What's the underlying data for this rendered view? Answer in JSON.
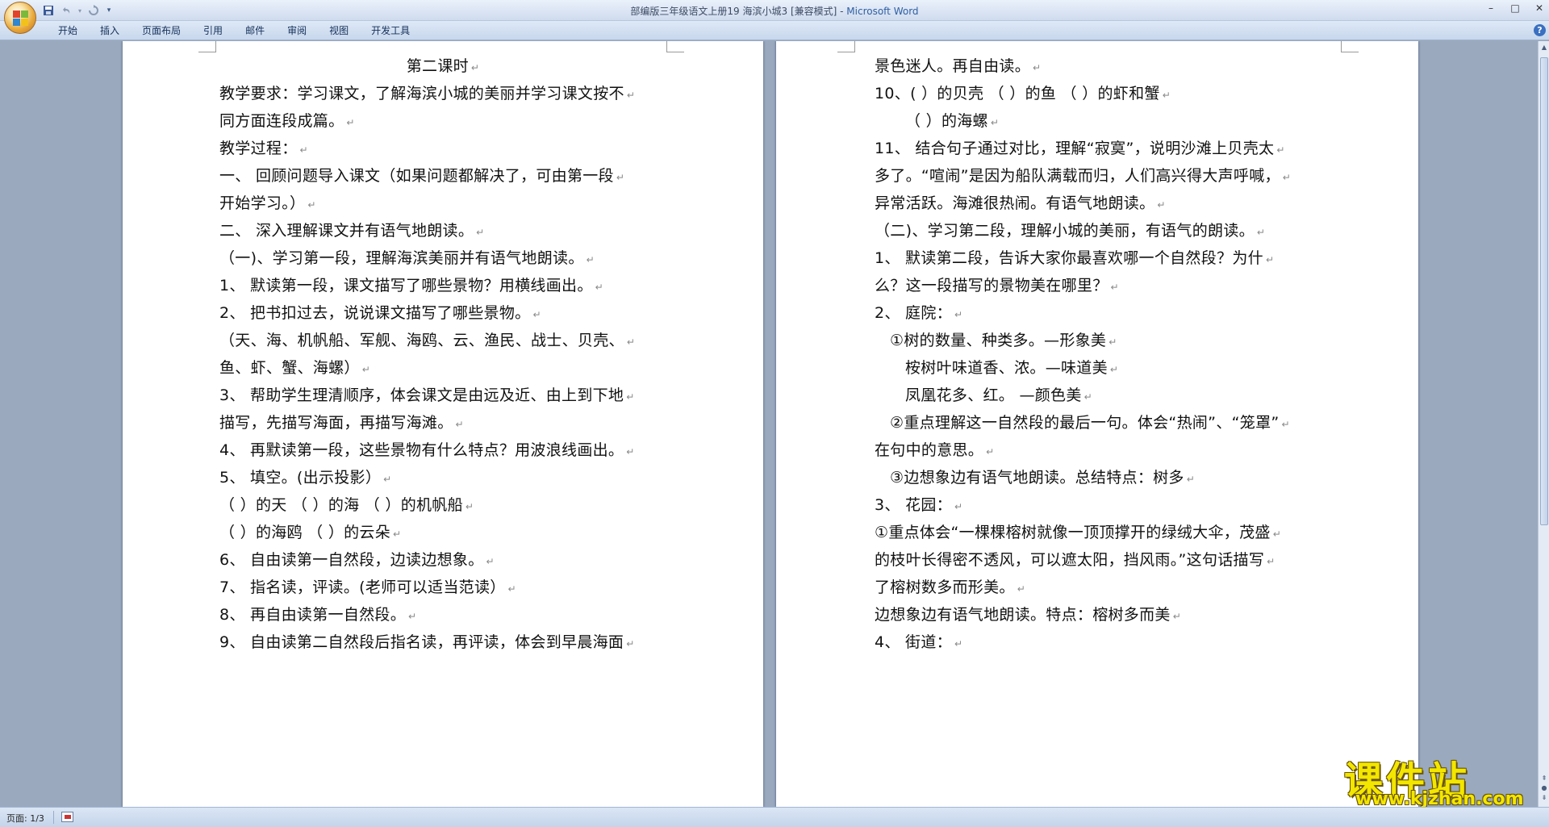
{
  "window": {
    "title_doc": "部编版三年级语文上册19 海滨小城3 [兼容模式] - ",
    "title_app": "Microsoft Word",
    "minimize": "–",
    "maximize": "□",
    "close": "✕"
  },
  "quick_access": {
    "save_icon": "save-icon",
    "undo_icon": "undo-icon",
    "redo_icon": "redo-icon",
    "customize_icon": "dropdown-icon"
  },
  "ribbon_tabs": [
    "开始",
    "插入",
    "页面布局",
    "引用",
    "邮件",
    "审阅",
    "视图",
    "开发工具"
  ],
  "help": "?",
  "document": {
    "left_page": [
      {
        "text": "第二课时",
        "indent": "center"
      },
      {
        "text": "教学要求：学习课文，了解海滨小城的美丽并学习课文按不",
        "indent": "0"
      },
      {
        "text": "同方面连段成篇。",
        "indent": "0"
      },
      {
        "text": "教学过程：",
        "indent": "0"
      },
      {
        "text": "一、  回顾问题导入课文（如果问题都解决了，可由第一段",
        "indent": "0"
      },
      {
        "text": "开始学习。）",
        "indent": "0"
      },
      {
        "text": "二、  深入理解课文并有语气地朗读。",
        "indent": "0"
      },
      {
        "text": "（一)、学习第一段，理解海滨美丽并有语气地朗读。",
        "indent": "0"
      },
      {
        "text": "1、  默读第一段，课文描写了哪些景物？用横线画出。",
        "indent": "0"
      },
      {
        "text": "2、  把书扣过去，说说课文描写了哪些景物。",
        "indent": "0"
      },
      {
        "text": "（天、海、机帆船、军舰、海鸥、云、渔民、战士、贝壳、",
        "indent": "0"
      },
      {
        "text": "鱼、虾、蟹、海螺）",
        "indent": "0"
      },
      {
        "text": "3、  帮助学生理清顺序，体会课文是由远及近、由上到下地",
        "indent": "0"
      },
      {
        "text": "描写，先描写海面，再描写海滩。",
        "indent": "0"
      },
      {
        "text": "4、  再默读第一段，这些景物有什么特点？用波浪线画出。",
        "indent": "0"
      },
      {
        "text": "5、  填空。(出示投影）",
        "indent": "0"
      },
      {
        "text": "（    ）的天      （    ）的海      （    ）的机帆船",
        "indent": "0"
      },
      {
        "text": "（    ）的海鸥    （    ）的云朵",
        "indent": "0"
      },
      {
        "text": "6、  自由读第一自然段，边读边想象。",
        "indent": "0"
      },
      {
        "text": "7、  指名读，评读。(老师可以适当范读）",
        "indent": "0"
      },
      {
        "text": "8、  再自由读第一自然段。",
        "indent": "0"
      },
      {
        "text": "9、  自由读第二自然段后指名读，再评读，体会到早晨海面",
        "indent": "0"
      }
    ],
    "right_page": [
      {
        "text": "景色迷人。再自由读。",
        "indent": "0"
      },
      {
        "text": "10、(    ）的贝壳      （    ）的鱼     （    ）的虾和蟹",
        "indent": "0"
      },
      {
        "text": "（    ）的海螺",
        "indent": "1"
      },
      {
        "text": "11、  结合句子通过对比，理解“寂寞”，说明沙滩上贝壳太",
        "indent": "0"
      },
      {
        "text": "多了。“喧闹”是因为船队满载而归，人们高兴得大声呼喊，",
        "indent": "0"
      },
      {
        "text": "异常活跃。海滩很热闹。有语气地朗读。",
        "indent": "0"
      },
      {
        "text": "（二)、学习第二段，理解小城的美丽，有语气的朗读。",
        "indent": "0"
      },
      {
        "text": "1、  默读第二段，告诉大家你最喜欢哪一个自然段？为什",
        "indent": "0"
      },
      {
        "text": "么？这一段描写的景物美在哪里？",
        "indent": "0"
      },
      {
        "text": "2、  庭院：",
        "indent": "0"
      },
      {
        "text": "①树的数量、种类多。—形象美",
        "indent": "0.5"
      },
      {
        "text": "桉树叶味道香、浓。—味道美",
        "indent": "1"
      },
      {
        "text": "凤凰花多、红。      —颜色美",
        "indent": "1"
      },
      {
        "text": "②重点理解这一自然段的最后一句。体会“热闹”、“笼罩”",
        "indent": "0.5"
      },
      {
        "text": "在句中的意思。",
        "indent": "0"
      },
      {
        "text": "③边想象边有语气地朗读。总结特点：树多",
        "indent": "0.5"
      },
      {
        "text": "3、  花园：",
        "indent": "0"
      },
      {
        "text": "①重点体会“一棵棵榕树就像一顶顶撑开的绿绒大伞，茂盛",
        "indent": "0"
      },
      {
        "text": "的枝叶长得密不透风，可以遮太阳，挡风雨。”这句话描写",
        "indent": "0"
      },
      {
        "text": "了榕树数多而形美。",
        "indent": "0"
      },
      {
        "text": "边想象边有语气地朗读。特点：榕树多而美",
        "indent": "0"
      },
      {
        "text": "4、  街道：",
        "indent": "0"
      }
    ],
    "return_mark": "↵"
  },
  "status": {
    "page_info": "页面: 1/3"
  },
  "watermark": {
    "big": "课件站",
    "url": "www.kjzhan.com"
  },
  "colors": {
    "background": "#9aa9bd",
    "title_app": "#2e5fa3",
    "watermark": "#f3e600"
  }
}
